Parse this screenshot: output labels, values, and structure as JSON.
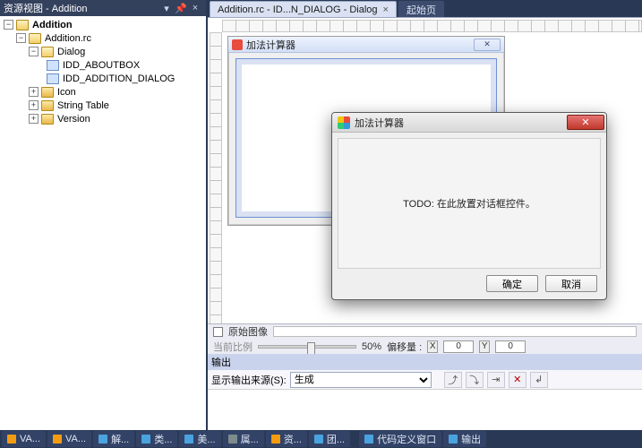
{
  "resource_pane": {
    "title": "资源视图 - Addition",
    "pin_tip": "▾",
    "close_tip": "×",
    "tree": {
      "root": "Addition",
      "rc": "Addition.rc",
      "dialog": "Dialog",
      "dlg1": "IDD_ABOUTBOX",
      "dlg2": "IDD_ADDITION_DIALOG",
      "icon": "Icon",
      "stringtable": "String Table",
      "version": "Version"
    }
  },
  "tabs": {
    "active": "Addition.rc - ID...N_DIALOG - Dialog",
    "inactive": "起始页"
  },
  "design_dialog": {
    "title": "加法计算器",
    "close": "✕"
  },
  "editor_strip": {
    "original_image": "原始图像",
    "zoom_label": "当前比例",
    "zoom_pct": "50%",
    "offset_label": "偏移量 : ",
    "x": "X",
    "y": "Y",
    "x_val": "0",
    "y_val": "0"
  },
  "output_pane": {
    "title": "输出",
    "src_label": "显示输出来源(S):",
    "src_value": "生成"
  },
  "run_dialog": {
    "title": "加法计算器",
    "body": "TODO: 在此放置对话框控件。",
    "ok": "确定",
    "cancel": "取消"
  },
  "statusbar": {
    "items": [
      "VA...",
      "VA...",
      "解...",
      "类...",
      "美...",
      "属...",
      "资...",
      "团..."
    ],
    "right": [
      "代码定义窗口",
      "输出"
    ],
    "colors": [
      "#f39c12",
      "#f39c12",
      "#4aa3df",
      "#4aa3df",
      "#4aa3df",
      "#7f8c8d",
      "#f39c12",
      "#4aa3df"
    ]
  }
}
